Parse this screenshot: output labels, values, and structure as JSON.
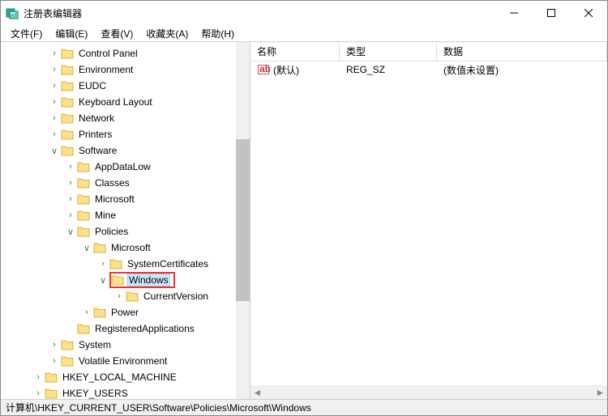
{
  "window": {
    "title": "注册表编辑器"
  },
  "menubar": {
    "file": "文件(F)",
    "edit": "编辑(E)",
    "view": "查看(V)",
    "favorites": "收藏夹(A)",
    "help": "帮助(H)"
  },
  "tree": {
    "items": [
      {
        "indent": 2,
        "toggle": ">",
        "label": "Control Panel"
      },
      {
        "indent": 2,
        "toggle": ">",
        "label": "Environment"
      },
      {
        "indent": 2,
        "toggle": ">",
        "label": "EUDC"
      },
      {
        "indent": 2,
        "toggle": ">",
        "label": "Keyboard Layout"
      },
      {
        "indent": 2,
        "toggle": ">",
        "label": "Network"
      },
      {
        "indent": 2,
        "toggle": ">",
        "label": "Printers"
      },
      {
        "indent": 2,
        "toggle": "v",
        "label": "Software"
      },
      {
        "indent": 3,
        "toggle": ">",
        "label": "AppDataLow"
      },
      {
        "indent": 3,
        "toggle": ">",
        "label": "Classes"
      },
      {
        "indent": 3,
        "toggle": ">",
        "label": "Microsoft"
      },
      {
        "indent": 3,
        "toggle": ">",
        "label": "Mine"
      },
      {
        "indent": 3,
        "toggle": "v",
        "label": "Policies"
      },
      {
        "indent": 4,
        "toggle": "v",
        "label": "Microsoft"
      },
      {
        "indent": 5,
        "toggle": ">",
        "label": "SystemCertificates"
      },
      {
        "indent": 5,
        "toggle": "v",
        "label": "Windows",
        "selected": true,
        "highlighted": true
      },
      {
        "indent": 6,
        "toggle": ">",
        "label": "CurrentVersion"
      },
      {
        "indent": 4,
        "toggle": ">",
        "label": "Power"
      },
      {
        "indent": 3,
        "toggle": "",
        "label": "RegisteredApplications"
      },
      {
        "indent": 2,
        "toggle": ">",
        "label": "System"
      },
      {
        "indent": 2,
        "toggle": ">",
        "label": "Volatile Environment"
      },
      {
        "indent": 1,
        "toggle": ">",
        "label": "HKEY_LOCAL_MACHINE"
      },
      {
        "indent": 1,
        "toggle": ">",
        "label": "HKEY_USERS"
      }
    ]
  },
  "list": {
    "headers": {
      "name": "名称",
      "type": "类型",
      "data": "数据"
    },
    "rows": [
      {
        "name": "(默认)",
        "type": "REG_SZ",
        "data": "(数值未设置)"
      }
    ]
  },
  "statusbar": {
    "path": "计算机\\HKEY_CURRENT_USER\\Software\\Policies\\Microsoft\\Windows"
  }
}
